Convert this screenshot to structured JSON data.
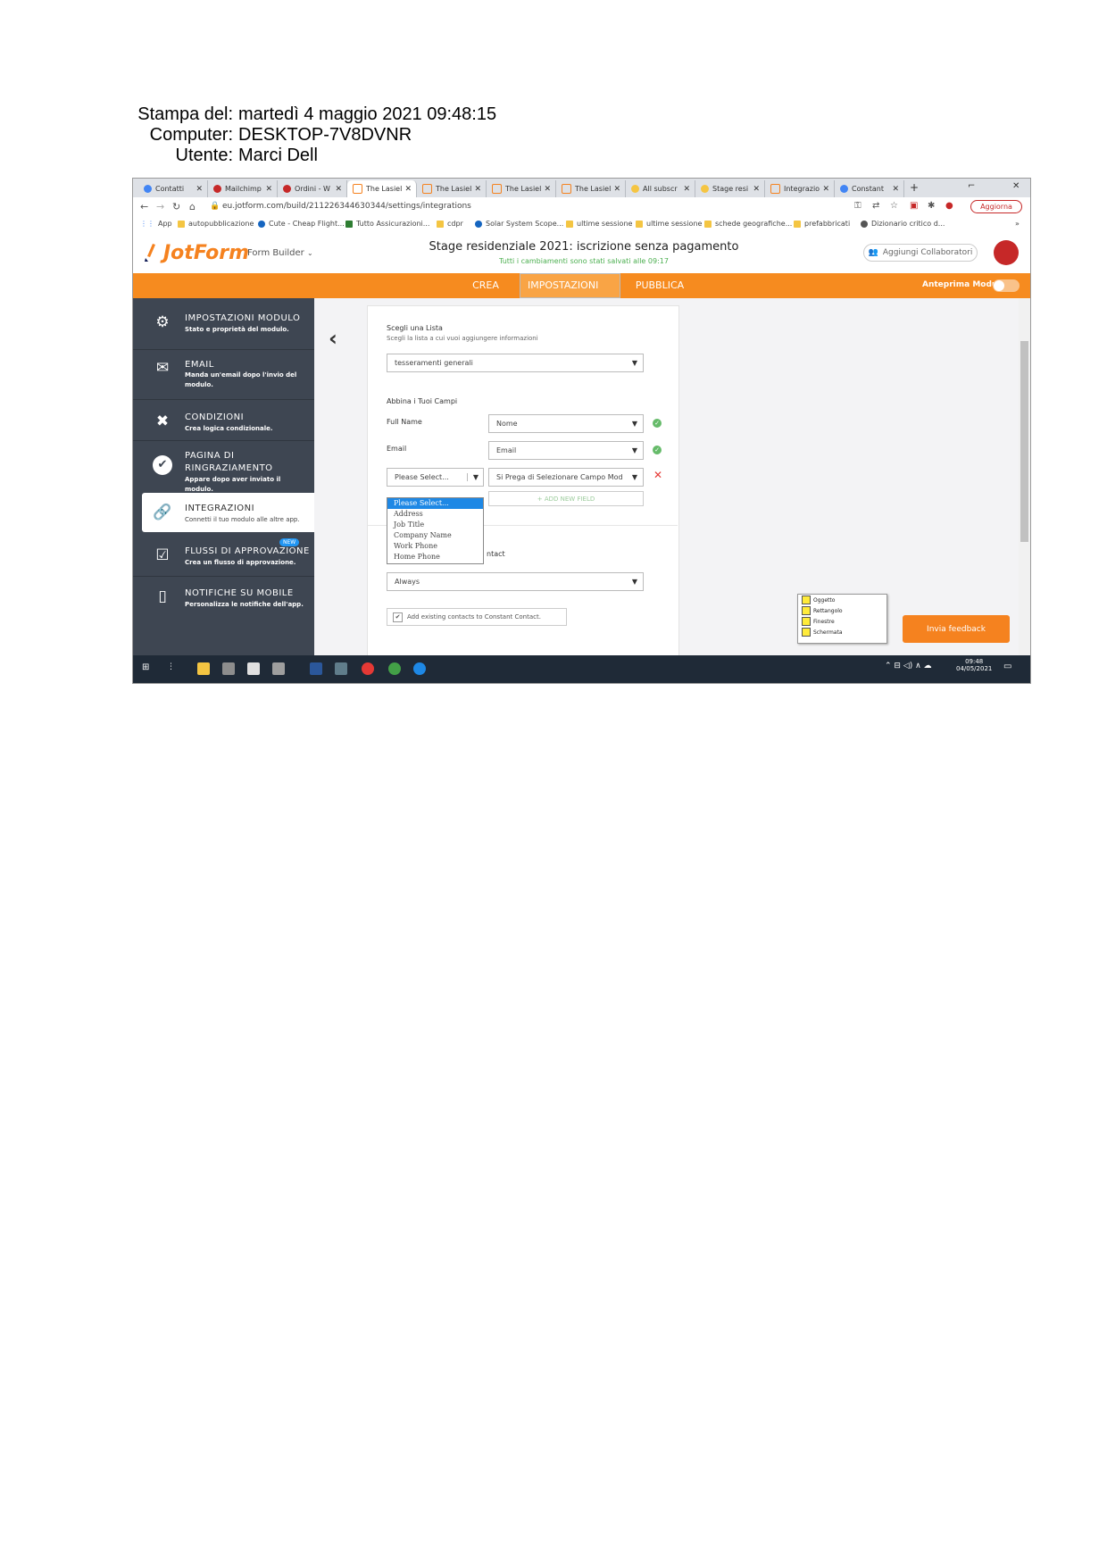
{
  "print_header": {
    "rows": [
      {
        "key": "Stampa del:",
        "value": "martedì 4 maggio 2021 09:48:15"
      },
      {
        "key": "Computer:",
        "value": "DESKTOP-7V8DVNR"
      },
      {
        "key": "Utente:",
        "value": "Marci Dell"
      }
    ]
  },
  "browser": {
    "tabs": [
      {
        "label": "Contatti",
        "color": "#4285f4"
      },
      {
        "label": "Mailchimp",
        "color": "#c62828"
      },
      {
        "label": "Ordini - W",
        "color": "#c62828"
      },
      {
        "label": "The Lasiel",
        "color": "#f5821f"
      },
      {
        "label": "The Lasiel",
        "color": "#f5821f"
      },
      {
        "label": "The Lasiel",
        "color": "#f5821f"
      },
      {
        "label": "The Lasiel",
        "color": "#f5821f"
      },
      {
        "label": "All subscr",
        "color": "#f5c542"
      },
      {
        "label": "Stage resi",
        "color": "#f5c542"
      },
      {
        "label": "Integrazio",
        "color": "#f5821f"
      },
      {
        "label": "Constant",
        "color": "#4285f4"
      }
    ],
    "new_tab": "+",
    "url": "eu.jotform.com/build/211226344630344/settings/integrations",
    "update_button": "Aggiorna",
    "bookmarks": [
      "App",
      "autopubblicazione",
      "Cute - Cheap Flight...",
      "Tutto Assicurazioni...",
      "cdpr",
      "Solar System Scope...",
      "ultime sessione",
      "ultime sessione",
      "schede geografiche...",
      "prefabbricati",
      "Dizionario critico d..."
    ],
    "more_bookmarks": "»"
  },
  "jotform": {
    "logo": "JotForm",
    "form_builder": "Form Builder",
    "form_title": "Stage residenziale 2021: iscrizione senza pagamento",
    "save_status": "Tutti i cambiamenti sono stati salvati alle 09:17",
    "collab_button": "Aggiungi Collaboratori",
    "nav": {
      "tabs": [
        "CREA",
        "IMPOSTAZIONI",
        "PUBBLICA"
      ],
      "selected": 1
    },
    "preview_label": "Anteprima Modulo"
  },
  "sidebar": {
    "items": [
      {
        "title": "IMPOSTAZIONI MODULO",
        "desc": "Stato e proprietà del modulo.",
        "icon": "gear-icon"
      },
      {
        "title": "EMAIL",
        "desc": "Manda un'email dopo l'invio del modulo.",
        "icon": "envelope-icon"
      },
      {
        "title": "CONDIZIONI",
        "desc": "Crea logica condizionale.",
        "icon": "tools-icon"
      },
      {
        "title": "PAGINA DI RINGRAZIAMENTO",
        "desc": "Appare dopo aver inviato il modulo.",
        "icon": "check-circle-icon"
      },
      {
        "title": "INTEGRAZIONI",
        "desc": "Connetti il tuo modulo alle altre app.",
        "icon": "link-icon"
      },
      {
        "title": "FLUSSI DI APPROVAZIONE",
        "desc": "Crea un flusso di approvazione.",
        "icon": "approval-icon",
        "badge": "NEW"
      },
      {
        "title": "NOTIFICHE SU MOBILE",
        "desc": "Personalizza le notifiche dell'app.",
        "icon": "mobile-icon"
      }
    ],
    "active_index": 4
  },
  "integration": {
    "list_label": "Scegli una Lista",
    "list_sub": "Scegli la lista a cui vuoi aggiungere informazioni",
    "list_value": "tesseramenti generali",
    "match_label": "Abbina i Tuoi Campi",
    "fields": [
      {
        "label": "Full Name",
        "value": "Nome"
      },
      {
        "label": "Email",
        "value": "Email"
      }
    ],
    "extra_left": "Please Select...",
    "extra_right": "Si Prega di Selezionare Campo Mod",
    "add_field": "+ ADD NEW FIELD",
    "dropdown_options": [
      "Please Select...",
      "Address",
      "Job Title",
      "Company Name",
      "Work Phone",
      "Home Phone"
    ],
    "partial_text": "ntact",
    "always_value": "Always",
    "checkbox_label": "Add existing contacts to Constant Contact.",
    "checkbox_mark": "✔"
  },
  "note_popup": {
    "rows": [
      "Oggetto",
      "Rettangolo",
      "Finestre",
      "Schermata"
    ]
  },
  "feedback_button": "Invia feedback",
  "taskbar": {
    "time": "09:48",
    "date": "04/05/2021"
  }
}
